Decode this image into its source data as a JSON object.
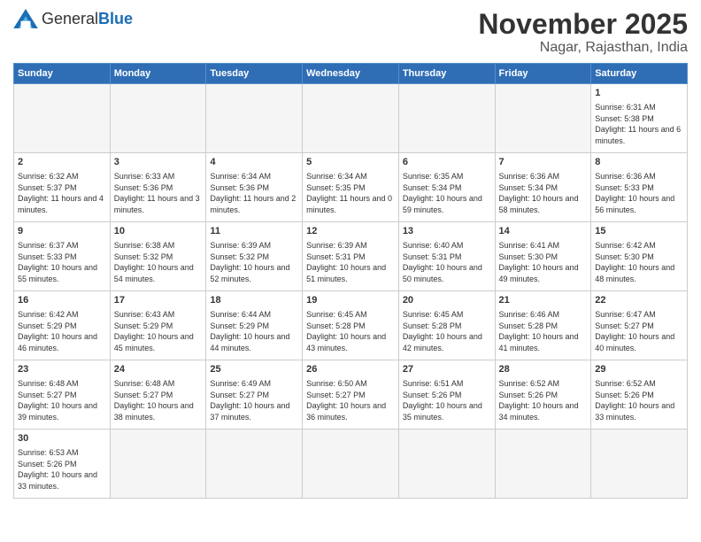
{
  "header": {
    "logo_general": "General",
    "logo_blue": "Blue",
    "main_title": "November 2025",
    "subtitle": "Nagar, Rajasthan, India"
  },
  "days_of_week": [
    "Sunday",
    "Monday",
    "Tuesday",
    "Wednesday",
    "Thursday",
    "Friday",
    "Saturday"
  ],
  "weeks": [
    [
      {
        "day": "",
        "info": ""
      },
      {
        "day": "",
        "info": ""
      },
      {
        "day": "",
        "info": ""
      },
      {
        "day": "",
        "info": ""
      },
      {
        "day": "",
        "info": ""
      },
      {
        "day": "",
        "info": ""
      },
      {
        "day": "1",
        "info": "Sunrise: 6:31 AM\nSunset: 5:38 PM\nDaylight: 11 hours\nand 6 minutes."
      }
    ],
    [
      {
        "day": "2",
        "info": "Sunrise: 6:32 AM\nSunset: 5:37 PM\nDaylight: 11 hours\nand 4 minutes."
      },
      {
        "day": "3",
        "info": "Sunrise: 6:33 AM\nSunset: 5:36 PM\nDaylight: 11 hours\nand 3 minutes."
      },
      {
        "day": "4",
        "info": "Sunrise: 6:34 AM\nSunset: 5:36 PM\nDaylight: 11 hours\nand 2 minutes."
      },
      {
        "day": "5",
        "info": "Sunrise: 6:34 AM\nSunset: 5:35 PM\nDaylight: 11 hours\nand 0 minutes."
      },
      {
        "day": "6",
        "info": "Sunrise: 6:35 AM\nSunset: 5:34 PM\nDaylight: 10 hours\nand 59 minutes."
      },
      {
        "day": "7",
        "info": "Sunrise: 6:36 AM\nSunset: 5:34 PM\nDaylight: 10 hours\nand 58 minutes."
      },
      {
        "day": "8",
        "info": "Sunrise: 6:36 AM\nSunset: 5:33 PM\nDaylight: 10 hours\nand 56 minutes."
      }
    ],
    [
      {
        "day": "9",
        "info": "Sunrise: 6:37 AM\nSunset: 5:33 PM\nDaylight: 10 hours\nand 55 minutes."
      },
      {
        "day": "10",
        "info": "Sunrise: 6:38 AM\nSunset: 5:32 PM\nDaylight: 10 hours\nand 54 minutes."
      },
      {
        "day": "11",
        "info": "Sunrise: 6:39 AM\nSunset: 5:32 PM\nDaylight: 10 hours\nand 52 minutes."
      },
      {
        "day": "12",
        "info": "Sunrise: 6:39 AM\nSunset: 5:31 PM\nDaylight: 10 hours\nand 51 minutes."
      },
      {
        "day": "13",
        "info": "Sunrise: 6:40 AM\nSunset: 5:31 PM\nDaylight: 10 hours\nand 50 minutes."
      },
      {
        "day": "14",
        "info": "Sunrise: 6:41 AM\nSunset: 5:30 PM\nDaylight: 10 hours\nand 49 minutes."
      },
      {
        "day": "15",
        "info": "Sunrise: 6:42 AM\nSunset: 5:30 PM\nDaylight: 10 hours\nand 48 minutes."
      }
    ],
    [
      {
        "day": "16",
        "info": "Sunrise: 6:42 AM\nSunset: 5:29 PM\nDaylight: 10 hours\nand 46 minutes."
      },
      {
        "day": "17",
        "info": "Sunrise: 6:43 AM\nSunset: 5:29 PM\nDaylight: 10 hours\nand 45 minutes."
      },
      {
        "day": "18",
        "info": "Sunrise: 6:44 AM\nSunset: 5:29 PM\nDaylight: 10 hours\nand 44 minutes."
      },
      {
        "day": "19",
        "info": "Sunrise: 6:45 AM\nSunset: 5:28 PM\nDaylight: 10 hours\nand 43 minutes."
      },
      {
        "day": "20",
        "info": "Sunrise: 6:45 AM\nSunset: 5:28 PM\nDaylight: 10 hours\nand 42 minutes."
      },
      {
        "day": "21",
        "info": "Sunrise: 6:46 AM\nSunset: 5:28 PM\nDaylight: 10 hours\nand 41 minutes."
      },
      {
        "day": "22",
        "info": "Sunrise: 6:47 AM\nSunset: 5:27 PM\nDaylight: 10 hours\nand 40 minutes."
      }
    ],
    [
      {
        "day": "23",
        "info": "Sunrise: 6:48 AM\nSunset: 5:27 PM\nDaylight: 10 hours\nand 39 minutes."
      },
      {
        "day": "24",
        "info": "Sunrise: 6:48 AM\nSunset: 5:27 PM\nDaylight: 10 hours\nand 38 minutes."
      },
      {
        "day": "25",
        "info": "Sunrise: 6:49 AM\nSunset: 5:27 PM\nDaylight: 10 hours\nand 37 minutes."
      },
      {
        "day": "26",
        "info": "Sunrise: 6:50 AM\nSunset: 5:27 PM\nDaylight: 10 hours\nand 36 minutes."
      },
      {
        "day": "27",
        "info": "Sunrise: 6:51 AM\nSunset: 5:26 PM\nDaylight: 10 hours\nand 35 minutes."
      },
      {
        "day": "28",
        "info": "Sunrise: 6:52 AM\nSunset: 5:26 PM\nDaylight: 10 hours\nand 34 minutes."
      },
      {
        "day": "29",
        "info": "Sunrise: 6:52 AM\nSunset: 5:26 PM\nDaylight: 10 hours\nand 33 minutes."
      }
    ],
    [
      {
        "day": "30",
        "info": "Sunrise: 6:53 AM\nSunset: 5:26 PM\nDaylight: 10 hours\nand 33 minutes."
      },
      {
        "day": "",
        "info": ""
      },
      {
        "day": "",
        "info": ""
      },
      {
        "day": "",
        "info": ""
      },
      {
        "day": "",
        "info": ""
      },
      {
        "day": "",
        "info": ""
      },
      {
        "day": "",
        "info": ""
      }
    ]
  ]
}
